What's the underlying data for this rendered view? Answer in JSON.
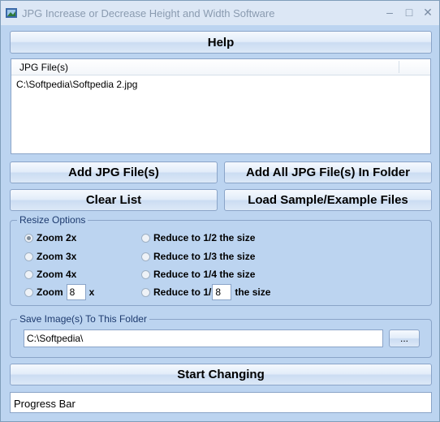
{
  "window": {
    "title": "JPG Increase or Decrease Height and Width Software"
  },
  "help_label": "Help",
  "file_list": {
    "header": "JPG File(s)",
    "rows": [
      "C:\\Softpedia\\Softpedia 2.jpg"
    ]
  },
  "buttons": {
    "add_files": "Add JPG File(s)",
    "add_folder": "Add All JPG File(s) In Folder",
    "clear_list": "Clear List",
    "load_sample": "Load Sample/Example Files",
    "start": "Start Changing",
    "browse": "..."
  },
  "resize": {
    "title": "Resize Options",
    "zoom2": "Zoom 2x",
    "zoom3": "Zoom 3x",
    "zoom4": "Zoom 4x",
    "zoom_custom_prefix": "Zoom",
    "zoom_custom_value": "8",
    "zoom_custom_suffix": "x",
    "reduce2": "Reduce to 1/2 the size",
    "reduce3": "Reduce to 1/3 the size",
    "reduce4": "Reduce to 1/4 the size",
    "reduce_custom_prefix": "Reduce to 1/",
    "reduce_custom_value": "8",
    "reduce_custom_suffix": "the size",
    "selected": "zoom2"
  },
  "save": {
    "title": "Save Image(s) To This Folder",
    "path": "C:\\Softpedia\\"
  },
  "progress": {
    "label": "Progress Bar"
  }
}
